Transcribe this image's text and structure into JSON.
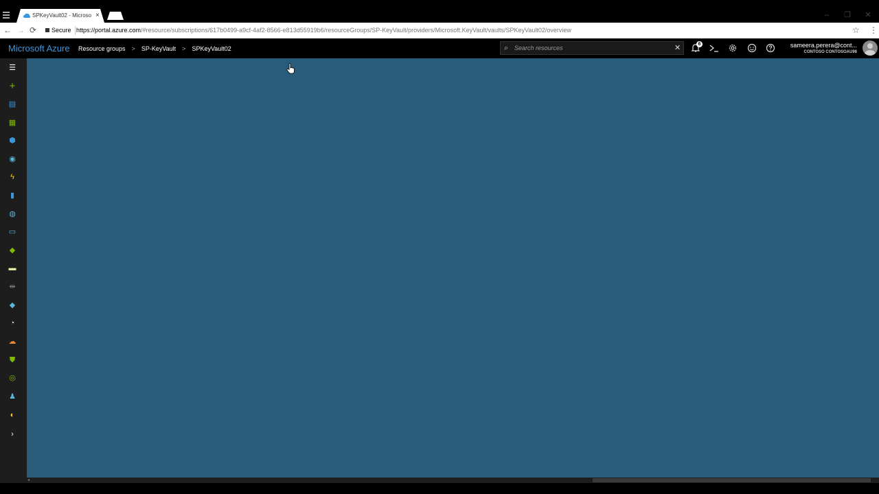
{
  "browser": {
    "tab_title": "SPKeyVault02 - Microsof",
    "tab_close": "×",
    "secure_label": "Secure",
    "url_host": "https://portal.azure.com",
    "url_path": "/#resource/subscriptions/617b0499-a9cf-4af2-8566-e813d55919b6/resourceGroups/SP-KeyVault/providers/Microsoft.KeyVault/vaults/SPKeyVault02/overview",
    "window_controls": {
      "minimize": "–",
      "restore": "❐",
      "close": "✕"
    },
    "nav": {
      "back": "←",
      "forward": "→",
      "reload": "⟳"
    },
    "bookmark_icon": "star-icon",
    "menu_icon": "kebab-icon"
  },
  "header": {
    "brand": "Microsoft Azure",
    "breadcrumbs": [
      "Resource groups",
      "SP-KeyVault",
      "SPKeyVault02"
    ],
    "breadcrumb_separator": ">",
    "search": {
      "placeholder": "Search resources",
      "clear": "✕"
    },
    "notifications_count": "6",
    "icons": [
      "bell-icon",
      "cloud-shell-icon",
      "settings-icon",
      "feedback-smiley-icon",
      "help-icon"
    ],
    "user": {
      "email": "sameera.perera@cont...",
      "tenant": "CONTOSO CONTOSOAU98"
    }
  },
  "sidebar": {
    "items": [
      {
        "name": "hamburger-menu",
        "glyph": "☰",
        "color": "#ffffff"
      },
      {
        "name": "create-resource",
        "glyph": "+",
        "color": "#7fba00"
      },
      {
        "name": "dashboard",
        "glyph": "▤",
        "color": "#3a96dd"
      },
      {
        "name": "all-resources",
        "glyph": "▦",
        "color": "#7fba00"
      },
      {
        "name": "resource-groups",
        "glyph": "⬢",
        "color": "#3a96dd"
      },
      {
        "name": "app-services",
        "glyph": "◉",
        "color": "#59b4d9"
      },
      {
        "name": "function-apps",
        "glyph": "ϟ",
        "color": "#fcd116"
      },
      {
        "name": "sql-databases",
        "glyph": "▮",
        "color": "#3a96dd"
      },
      {
        "name": "cosmos-db",
        "glyph": "◍",
        "color": "#59b4d9"
      },
      {
        "name": "virtual-machines",
        "glyph": "▭",
        "color": "#59b4d9"
      },
      {
        "name": "load-balancers",
        "glyph": "◆",
        "color": "#7fba00"
      },
      {
        "name": "storage-accounts",
        "glyph": "▬",
        "color": "#e8e8a0"
      },
      {
        "name": "virtual-networks",
        "glyph": "⇹",
        "color": "#888888"
      },
      {
        "name": "azure-active-directory",
        "glyph": "◆",
        "color": "#59b4d9"
      },
      {
        "name": "monitor",
        "glyph": "◔",
        "color": "#dddddd"
      },
      {
        "name": "advisor",
        "glyph": "☁",
        "color": "#e88a3a"
      },
      {
        "name": "security-center",
        "glyph": "⛊",
        "color": "#7fba00"
      },
      {
        "name": "cost-management",
        "glyph": "◎",
        "color": "#7fba00"
      },
      {
        "name": "help-support",
        "glyph": "♟",
        "color": "#59b4d9"
      },
      {
        "name": "key-vaults",
        "glyph": "◐",
        "color": "#fcd116"
      },
      {
        "name": "more-services",
        "glyph": "›",
        "color": "#ffffff"
      }
    ]
  },
  "colors": {
    "main_background": "#285c7a",
    "brand": "#3a96dd",
    "sidebar": "#1d1d1d"
  }
}
